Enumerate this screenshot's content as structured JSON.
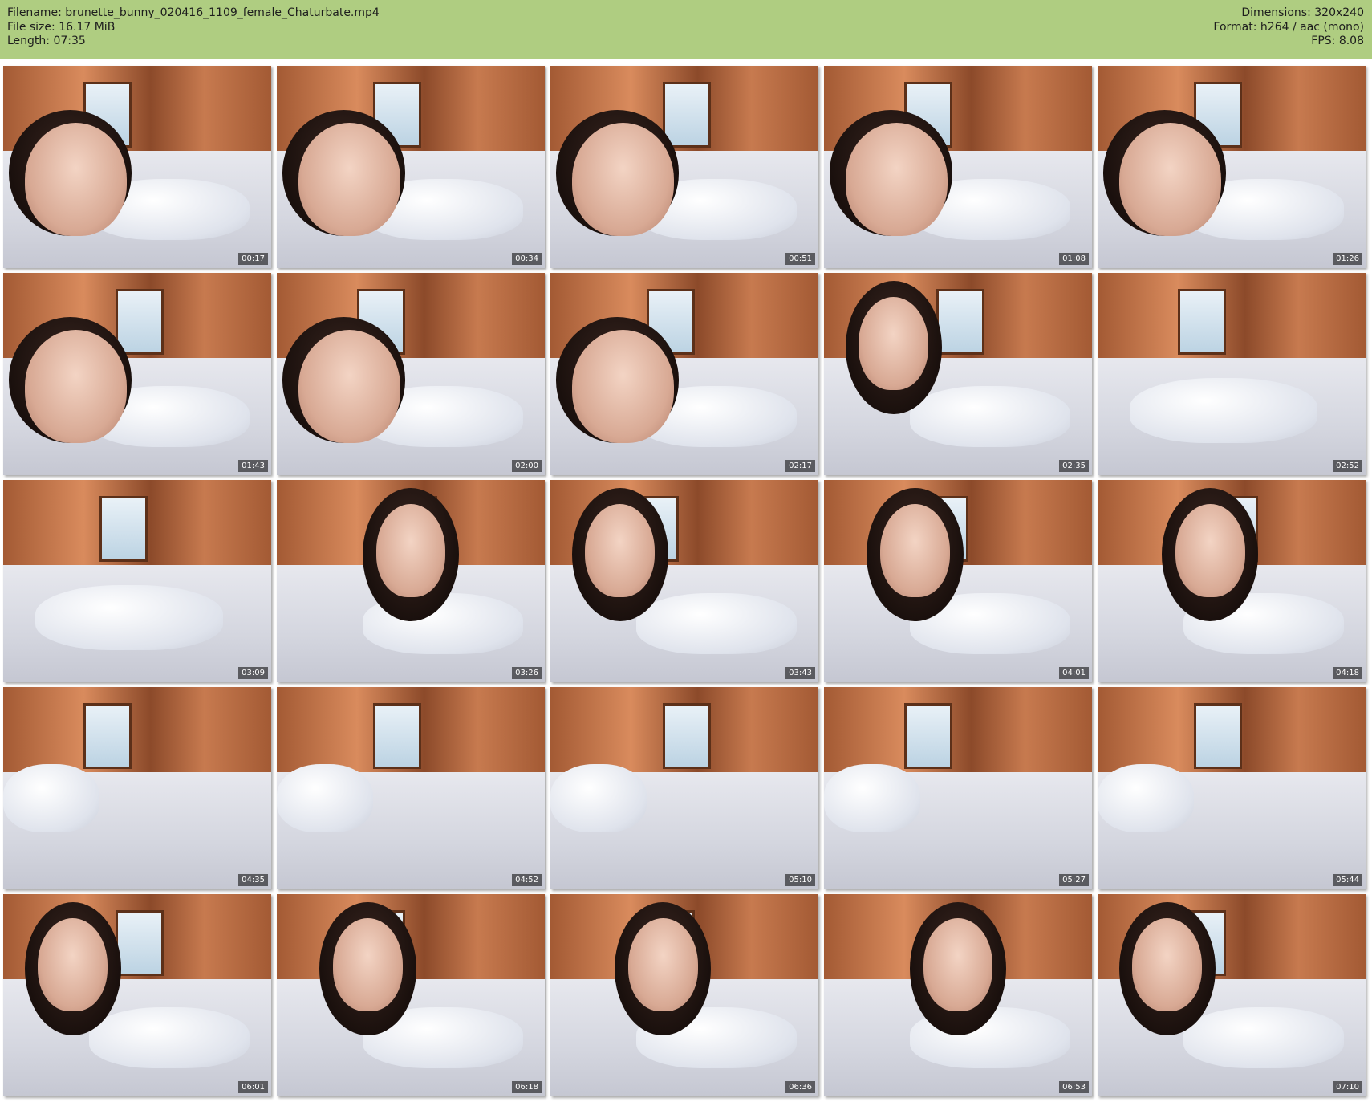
{
  "header": {
    "filename_label": "Filename: brunette_bunny_020416_1109_female_Chaturbate.mp4",
    "filesize_label": "File size: 16.17 MiB",
    "length_label": "Length: 07:35",
    "dimensions_label": "Dimensions: 320x240",
    "format_label": "Format: h264 / aac (mono)",
    "fps_label": "FPS: 8.08",
    "background_color": "#afcd81"
  },
  "thumbnails": [
    {
      "time": "00:17",
      "scene": "person-close"
    },
    {
      "time": "00:34",
      "scene": "person-close"
    },
    {
      "time": "00:51",
      "scene": "person-close"
    },
    {
      "time": "01:08",
      "scene": "person-close"
    },
    {
      "time": "01:26",
      "scene": "person-close"
    },
    {
      "time": "01:43",
      "scene": "person-close"
    },
    {
      "time": "02:00",
      "scene": "person-close"
    },
    {
      "time": "02:17",
      "scene": "person-close"
    },
    {
      "time": "02:35",
      "scene": "person-bed"
    },
    {
      "time": "02:52",
      "scene": "pillow"
    },
    {
      "time": "03:09",
      "scene": "pillow"
    },
    {
      "time": "03:26",
      "scene": "person-bed"
    },
    {
      "time": "03:43",
      "scene": "person-bed"
    },
    {
      "time": "04:01",
      "scene": "person-bed"
    },
    {
      "time": "04:18",
      "scene": "person-bed"
    },
    {
      "time": "04:35",
      "scene": "empty-bed"
    },
    {
      "time": "04:52",
      "scene": "empty-bed"
    },
    {
      "time": "05:10",
      "scene": "empty-bed"
    },
    {
      "time": "05:27",
      "scene": "empty-bed"
    },
    {
      "time": "05:44",
      "scene": "empty-bed"
    },
    {
      "time": "06:01",
      "scene": "person-bed"
    },
    {
      "time": "06:18",
      "scene": "person-bed"
    },
    {
      "time": "06:36",
      "scene": "person-bed"
    },
    {
      "time": "06:53",
      "scene": "person-bed"
    },
    {
      "time": "07:10",
      "scene": "person-bed"
    }
  ]
}
